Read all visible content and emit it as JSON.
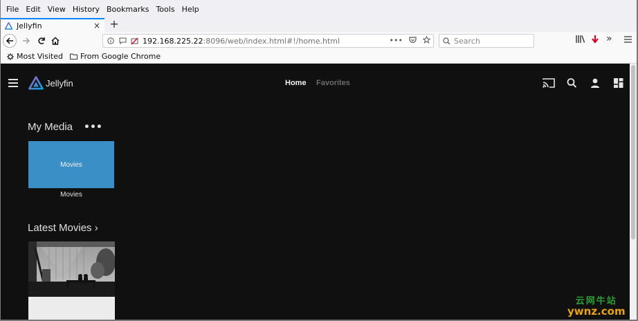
{
  "menubar": {
    "items": [
      "File",
      "Edit",
      "View",
      "History",
      "Bookmarks",
      "Tools",
      "Help"
    ],
    "underline_letters": [
      "F",
      "E",
      "V",
      "s",
      "B",
      "T",
      "H"
    ]
  },
  "tab": {
    "title": "Jellyfin",
    "close_glyph": "×",
    "new_tab_glyph": "+"
  },
  "navbar": {
    "url_host": "192.168.225.22",
    "url_rest": ":8096/web/index.html#!/home.html",
    "search_placeholder": "Search",
    "icons": [
      "back-arrow-icon",
      "forward-arrow-icon",
      "reload-icon",
      "home-icon",
      "info-icon",
      "chat-icon",
      "blocked-media-icon",
      "more-actions-icon",
      "pocket-icon",
      "bookmark-star-icon",
      "search-icon",
      "library-icon",
      "download-arrow-icon",
      "overflow-icon",
      "hamburger-menu-icon"
    ]
  },
  "bookmarks": {
    "items": [
      {
        "label": "Most Visited",
        "icon": "gear-icon"
      },
      {
        "label": "From Google Chrome",
        "icon": "folder-icon"
      }
    ]
  },
  "jellyfin": {
    "app_name": "Jellyfin",
    "tabs": [
      {
        "label": "Home",
        "active": true
      },
      {
        "label": "Favorites",
        "active": false
      }
    ],
    "header_icons": [
      "cast-icon",
      "search-icon",
      "user-icon",
      "dashboard-icon"
    ],
    "my_media": {
      "title": "My Media",
      "more_glyph": "•••",
      "items": [
        {
          "card_label": "Movies",
          "caption": "Movies"
        }
      ]
    },
    "latest_movies": {
      "title": "Latest Movies ›"
    }
  },
  "watermark": {
    "chinese": "云网牛站",
    "latin": "ywnz.com"
  },
  "colors": {
    "accent_tab": "#0a84ff",
    "jellyfin_bg": "#101010",
    "media_card": "#3b8fc7",
    "jellyfin_purple": "#aa5cc3",
    "jellyfin_blue": "#00a4dc",
    "download_red": "#d70022"
  }
}
